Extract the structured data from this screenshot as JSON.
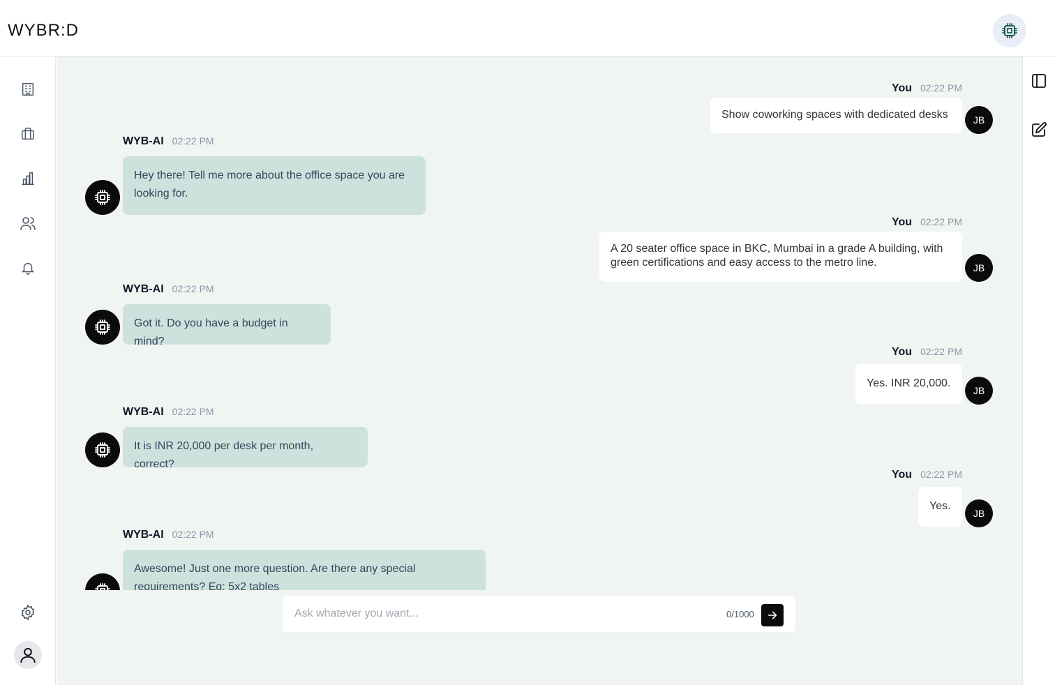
{
  "brand": {
    "logo_text": "WYBR:D"
  },
  "sidebar": {
    "items": [
      {
        "icon": "building-icon"
      },
      {
        "icon": "briefcase-icon"
      },
      {
        "icon": "bar-chart-icon"
      },
      {
        "icon": "users-icon"
      },
      {
        "icon": "bell-icon"
      }
    ],
    "bottom": [
      {
        "icon": "settings-icon"
      },
      {
        "icon": "user-avatar-icon"
      }
    ]
  },
  "rightbar": {
    "items": [
      {
        "icon": "panel-toggle-icon"
      },
      {
        "icon": "edit-icon"
      }
    ]
  },
  "messages": [
    {
      "sender": "You",
      "time": "02:22 PM",
      "text": "Show coworking spaces with dedicated desks",
      "avatar": "JB"
    },
    {
      "sender": "WYB-AI",
      "time": "02:22 PM",
      "text": "Hey there! Tell me more about the office space you are looking for."
    },
    {
      "sender": "You",
      "time": "02:22 PM",
      "text": "A 20 seater office space in BKC, Mumbai in a grade A building, with green certifications and easy access to the metro line.",
      "avatar": "JB"
    },
    {
      "sender": "WYB-AI",
      "time": "02:22 PM",
      "text": "Got it. Do you have a budget in mind?"
    },
    {
      "sender": "You",
      "time": "02:22 PM",
      "text": "Yes. INR 20,000.",
      "avatar": "JB"
    },
    {
      "sender": "WYB-AI",
      "time": "02:22 PM",
      "text": "It is INR 20,000 per desk per month, correct?"
    },
    {
      "sender": "You",
      "time": "02:22 PM",
      "text": "Yes.",
      "avatar": "JB"
    },
    {
      "sender": "WYB-AI",
      "time": "02:22 PM",
      "text": "Awesome! Just one more question. Are there any special requirements? Eg: 5x2 tables"
    }
  ],
  "composer": {
    "placeholder": "Ask whatever you want...",
    "value": "",
    "counter": "0/1000",
    "send_icon": "arrow-right-icon"
  },
  "colors": {
    "main_bg": "#f1f5f2",
    "ai_bubble": "#cde2dd",
    "user_bubble": "#ffffff",
    "avatar_bg": "#0b0b0b",
    "ai_button_bg": "#e8edf7"
  }
}
